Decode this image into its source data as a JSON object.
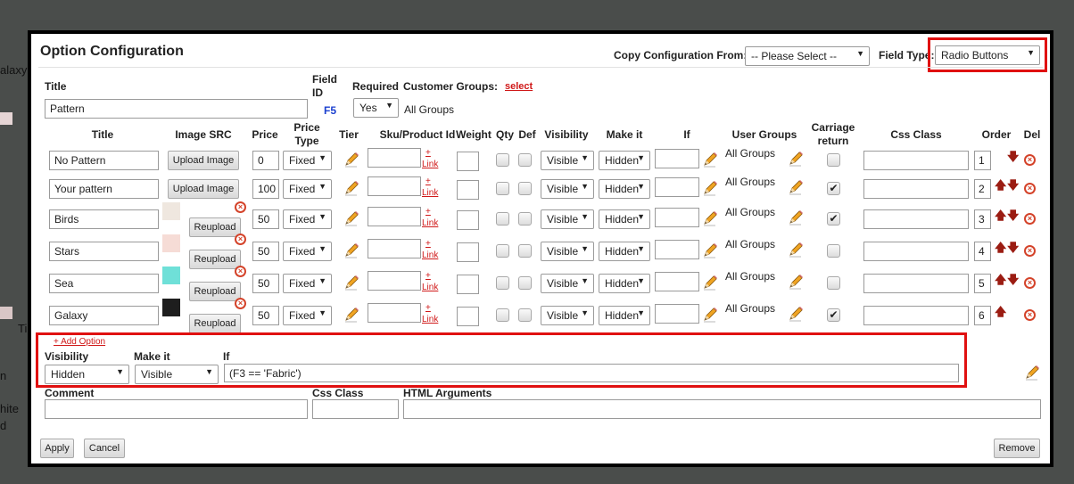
{
  "background": {
    "text1": "alaxy",
    "text2": "Ti",
    "text3": "n",
    "text4": "hite",
    "text5": "d"
  },
  "dialog": {
    "title": "Option Configuration",
    "copy_label": "Copy Configuration From:",
    "copy_value": "-- Please Select --",
    "field_type_label": "Field Type:",
    "field_type_value": "Radio Buttons"
  },
  "top": {
    "title_label": "Title",
    "title_value": "Pattern",
    "field_id_label": "Field ID",
    "field_id_value": "F5",
    "required_label": "Required",
    "required_value": "Yes",
    "groups_label": "Customer Groups:",
    "groups_select": "select",
    "groups_value": "All Groups"
  },
  "headers": {
    "title": "Title",
    "image": "Image SRC",
    "price": "Price",
    "price_type": "Price Type",
    "tier": "Tier",
    "sku": "Sku/Product Id",
    "weight": "Weight",
    "qty": "Qty",
    "def": "Def",
    "visibility": "Visibility",
    "make_it": "Make it",
    "if": "If",
    "user_groups": "User Groups",
    "carriage": "Carriage return",
    "css": "Css Class",
    "order": "Order",
    "del": "Del"
  },
  "rows": [
    {
      "title": "No Pattern",
      "img_button": "Upload Image",
      "price": "0",
      "price_type": "Fixed",
      "link_plus": "+",
      "link": "Link",
      "visibility": "Visible",
      "make_it": "Hidden",
      "groups": "All Groups",
      "carriage": false,
      "order": "1"
    },
    {
      "title": "Your pattern",
      "img_button": "Upload Image",
      "price": "100",
      "price_type": "Fixed",
      "link_plus": "+",
      "link": "Link",
      "visibility": "Visible",
      "make_it": "Hidden",
      "groups": "All Groups",
      "carriage": true,
      "order": "2"
    },
    {
      "title": "Birds",
      "img_button": "Reupload",
      "price": "50",
      "price_type": "Fixed",
      "link_plus": "+",
      "link": "Link",
      "visibility": "Visible",
      "make_it": "Hidden",
      "groups": "All Groups",
      "carriage": true,
      "order": "3",
      "thumb": "#efe7df"
    },
    {
      "title": "Stars",
      "img_button": "Reupload",
      "price": "50",
      "price_type": "Fixed",
      "link_plus": "+",
      "link": "Link",
      "visibility": "Visible",
      "make_it": "Hidden",
      "groups": "All Groups",
      "carriage": false,
      "order": "4",
      "thumb": "#f6dcd6"
    },
    {
      "title": "Sea",
      "img_button": "Reupload",
      "price": "50",
      "price_type": "Fixed",
      "link_plus": "+",
      "link": "Link",
      "visibility": "Visible",
      "make_it": "Hidden",
      "groups": "All Groups",
      "carriage": false,
      "order": "5",
      "thumb": "#6fe0d8"
    },
    {
      "title": "Galaxy",
      "img_button": "Reupload",
      "price": "50",
      "price_type": "Fixed",
      "link_plus": "+",
      "link": "Link",
      "visibility": "Visible",
      "make_it": "Hidden",
      "groups": "All Groups",
      "carriage": true,
      "order": "6",
      "thumb": "#1e1e1e"
    }
  ],
  "option_rule": {
    "add_option": "+ Add Option",
    "visibility_label": "Visibility",
    "visibility_value": "Hidden",
    "make_it_label": "Make it",
    "make_it_value": "Visible",
    "if_label": "If",
    "if_value": "(F3 == 'Fabric')"
  },
  "bottom": {
    "comment_label": "Comment",
    "css_label": "Css Class",
    "html_label": "HTML Arguments",
    "apply": "Apply",
    "cancel": "Cancel",
    "remove": "Remove"
  },
  "colors": {
    "highlight": "#e01010",
    "link": "#d01818",
    "field_id": "#1a3fcf",
    "delete": "#d4432a",
    "order_arrow": "#9b1c12"
  }
}
